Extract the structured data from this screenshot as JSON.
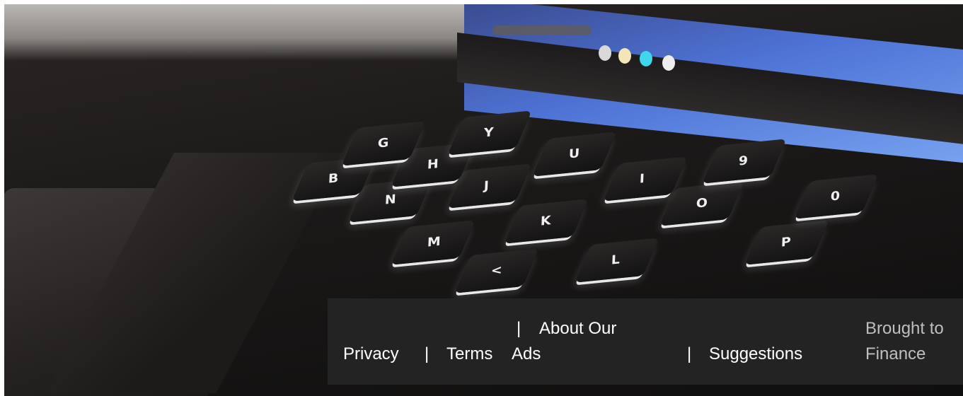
{
  "hero": {
    "image_alt": "Backlit laptop keyboard close-up",
    "keys": [
      "N",
      "M",
      "J",
      "K",
      "L",
      "O",
      "P",
      "U",
      "I",
      "9",
      "0",
      "H",
      "B",
      "G",
      "Y",
      "<"
    ]
  },
  "footer": {
    "links": {
      "privacy": "Privacy",
      "terms": "Terms",
      "about_ads_line1": "About Our",
      "about_ads_line2": "Ads",
      "suggestions": "Suggestions"
    },
    "separator": "|",
    "credit_line1": "Brought to",
    "credit_line2": "Finance"
  },
  "colors": {
    "footer_bg": "#232323",
    "footer_text": "#ffffff",
    "credit_text": "#bfbfbf"
  }
}
